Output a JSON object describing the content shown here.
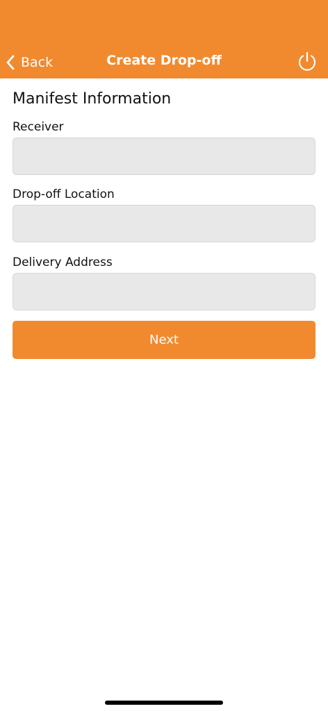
{
  "header": {
    "back_label": "Back",
    "title": "Create Drop-off",
    "background_color": "#F18A2F",
    "icons": {
      "back": "chevron-left-icon",
      "power": "power-icon"
    }
  },
  "form": {
    "section_title": "Manifest Information",
    "fields": [
      {
        "label": "Receiver",
        "value": ""
      },
      {
        "label": "Drop-off Location",
        "value": ""
      },
      {
        "label": "Delivery Address",
        "value": ""
      }
    ],
    "next_label": "Next",
    "button_color": "#F18A2F"
  }
}
